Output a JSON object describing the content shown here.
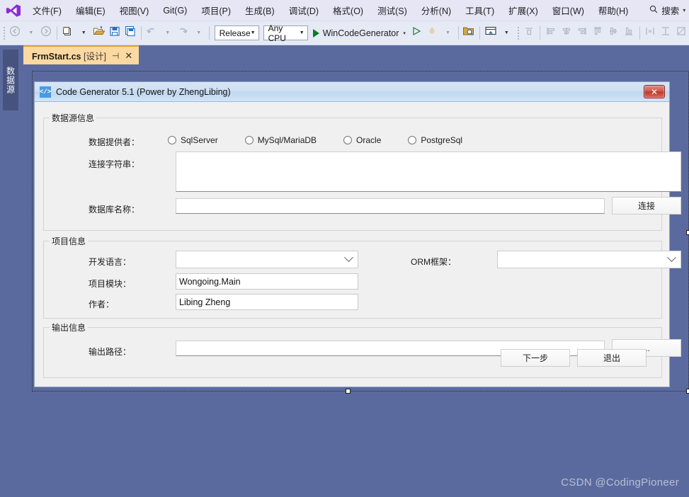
{
  "menubar": {
    "logo_icon": "visual-studio-logo",
    "items": [
      {
        "label": "文件(F)"
      },
      {
        "label": "编辑(E)"
      },
      {
        "label": "视图(V)"
      },
      {
        "label": "Git(G)"
      },
      {
        "label": "项目(P)"
      },
      {
        "label": "生成(B)"
      },
      {
        "label": "调试(D)"
      },
      {
        "label": "格式(O)"
      },
      {
        "label": "测试(S)"
      },
      {
        "label": "分析(N)"
      },
      {
        "label": "工具(T)"
      },
      {
        "label": "扩展(X)"
      },
      {
        "label": "窗口(W)"
      },
      {
        "label": "帮助(H)"
      }
    ],
    "search": {
      "icon": "search-icon",
      "label": "搜索",
      "caret": "▾"
    }
  },
  "toolbar": {
    "navigate_back_icon": "navigate-back-icon",
    "navigate_forward_icon": "navigate-forward-icon",
    "new_project_icon": "new-project-icon",
    "open_file_icon": "open-file-icon",
    "save_icon": "save-icon",
    "save_all_icon": "save-all-icon",
    "undo_icon": "undo-icon",
    "redo_icon": "redo-icon",
    "configuration": "Release",
    "platform": "Any CPU",
    "start_label": "WinCodeGenerator",
    "start_icon": "start-debug-icon",
    "start_caret": "▾",
    "attach_icon": "attach-process-icon",
    "hot_reload_icon": "hot-reload-icon",
    "find_in_files_icon": "find-in-files-icon",
    "solution_explorer_icon": "solution-explorer-icon",
    "tab_order_icon": "tab-order-icon",
    "align_left_icon": "align-left-icon",
    "align_center_icon": "align-center-icon",
    "align_right_icon": "align-right-icon",
    "align_top_icon": "align-top-icon",
    "align_middle_icon": "align-middle-icon",
    "align_bottom_icon": "align-bottom-icon",
    "make_same_width_icon": "make-same-width-icon",
    "make_same_height_icon": "make-same-height-icon",
    "make_same_size_icon": "make-same-size-icon"
  },
  "left_dock": {
    "tab_label": "数据源"
  },
  "tab": {
    "filename": "FrmStart.cs",
    "mode": "[设计]",
    "pin_icon": "pin-icon",
    "close_icon": "close-icon"
  },
  "form": {
    "icon": "code-generator-icon",
    "icon_glyph": "</>",
    "title": "Code Generator 5.1  (Power by ZhengLibing)",
    "close_label": "✕",
    "datasource_group": {
      "title": "数据源信息",
      "provider_label": "数据提供者：",
      "providers": [
        {
          "label": "SqlServer",
          "selected": false
        },
        {
          "label": "MySql/MariaDB",
          "selected": false
        },
        {
          "label": "Oracle",
          "selected": false
        },
        {
          "label": "PostgreSql",
          "selected": false
        }
      ],
      "connstr_label": "连接字符串：",
      "connstr_value": "",
      "dbname_label": "数据库名称：",
      "dbname_value": "",
      "connect_button": "连接"
    },
    "project_group": {
      "title": "项目信息",
      "language_label": "开发语言：",
      "language_value": "",
      "orm_label": "ORM框架：",
      "orm_value": "",
      "module_label": "项目模块：",
      "module_value": "Wongoing.Main",
      "author_label": "作者：",
      "author_value": "Libing Zheng"
    },
    "output_group": {
      "title": "输出信息",
      "path_label": "输出路径：",
      "path_value": "",
      "browse_button": "..."
    },
    "next_button": "下一步",
    "exit_button": "退出"
  },
  "watermark": "CSDN @CodingPioneer"
}
